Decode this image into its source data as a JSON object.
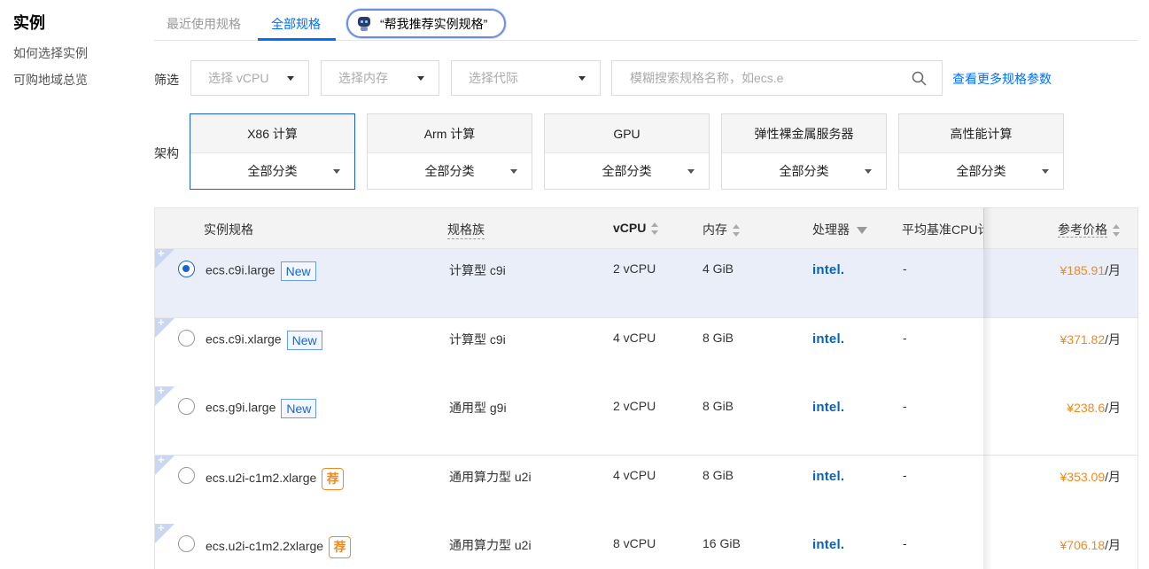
{
  "sidebar": {
    "title": "实例",
    "links": [
      "如何选择实例",
      "可购地域总览"
    ]
  },
  "tabs": {
    "recent": "最近使用规格",
    "all": "全部规格",
    "ai_prompt": "“帮我推荐实例规格”"
  },
  "filter": {
    "label": "筛选",
    "vcpu_placeholder": "选择 vCPU",
    "memory_placeholder": "选择内存",
    "generation_placeholder": "选择代际",
    "search_placeholder": "模糊搜索规格名称，如ecs.e",
    "more_link": "查看更多规格参数"
  },
  "architecture": {
    "label": "架构",
    "options": [
      {
        "name": "X86 计算",
        "category": "全部分类"
      },
      {
        "name": "Arm 计算",
        "category": "全部分类"
      },
      {
        "name": "GPU",
        "category": "全部分类"
      },
      {
        "name": "弹性裸金属服务器",
        "category": "全部分类"
      },
      {
        "name": "高性能计算",
        "category": "全部分类"
      }
    ]
  },
  "table": {
    "headers": {
      "spec": "实例规格",
      "family": "规格族",
      "vcpu": "vCPU",
      "memory": "内存",
      "processor": "处理器",
      "baseline": "平均基准CPU计",
      "price": "参考价格"
    },
    "rows": [
      {
        "spec": "ecs.c9i.large",
        "badge": "New",
        "family": "计算型 c9i",
        "vcpu": "2 vCPU",
        "memory": "4 GiB",
        "processor": "intel.",
        "baseline": "-",
        "price": "¥185.91",
        "unit": "/月",
        "selected": true
      },
      {
        "spec": "ecs.c9i.xlarge",
        "badge": "New",
        "family": "计算型 c9i",
        "vcpu": "4 vCPU",
        "memory": "8 GiB",
        "processor": "intel.",
        "baseline": "-",
        "price": "¥371.82",
        "unit": "/月",
        "selected": false
      },
      {
        "spec": "ecs.g9i.large",
        "badge": "New",
        "family": "通用型 g9i",
        "vcpu": "2 vCPU",
        "memory": "8 GiB",
        "processor": "intel.",
        "baseline": "-",
        "price": "¥238.6",
        "unit": "/月",
        "selected": false
      },
      {
        "spec": "ecs.u2i-c1m2.xlarge",
        "badge": "荐",
        "family": "通用算力型 u2i",
        "vcpu": "4 vCPU",
        "memory": "8 GiB",
        "processor": "intel.",
        "baseline": "-",
        "price": "¥353.09",
        "unit": "/月",
        "selected": false
      },
      {
        "spec": "ecs.u2i-c1m2.2xlarge",
        "badge": "荐",
        "family": "通用算力型 u2i",
        "vcpu": "8 vCPU",
        "memory": "16 GiB",
        "processor": "intel.",
        "baseline": "-",
        "price": "¥706.18",
        "unit": "/月",
        "selected": false
      }
    ],
    "corner_mark": "+"
  },
  "colors": {
    "accent": "#006eff",
    "price": "#ef8a1e",
    "selected_row": "#e9eef8"
  }
}
